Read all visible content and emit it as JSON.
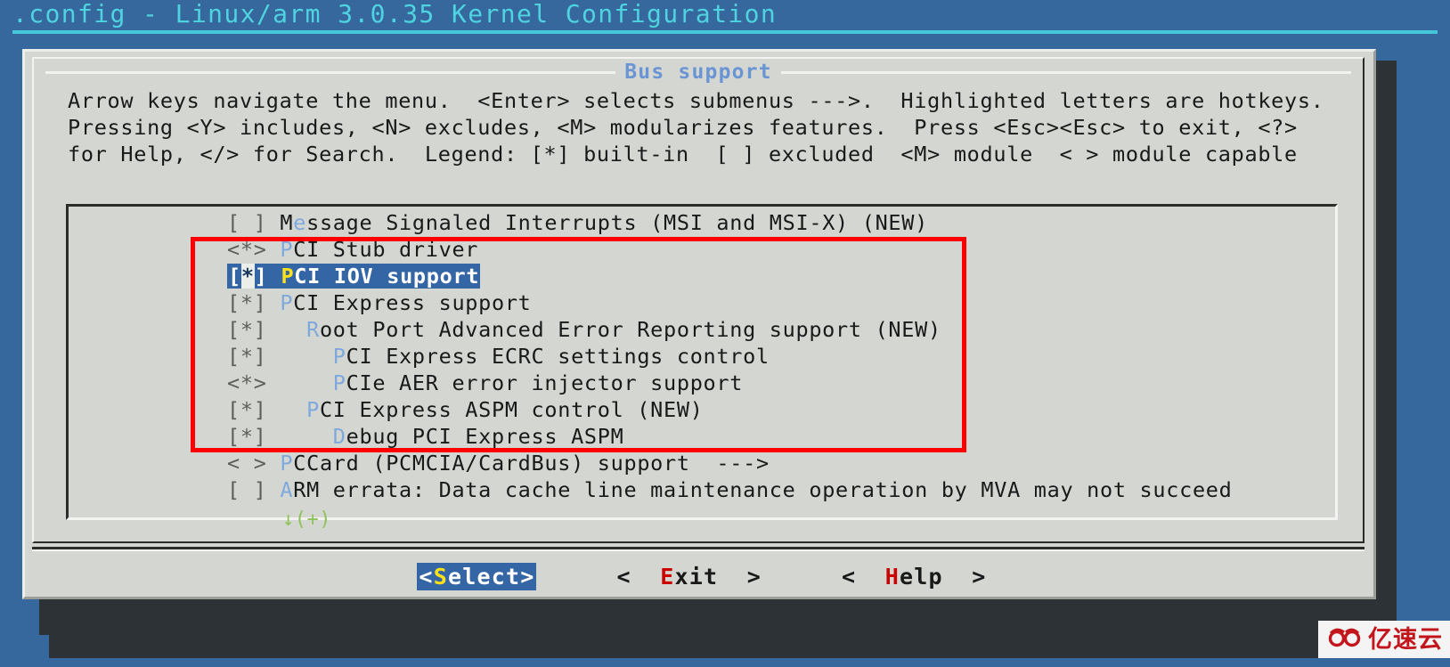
{
  "terminal": {
    "title": ".config - Linux/arm 3.0.35 Kernel Configuration",
    "title_color": "#4fd3e0",
    "background_color": "#36689e"
  },
  "dialog": {
    "caption": "Bus support",
    "caption_color": "#6a94d4",
    "background_color": "#d4d7d1",
    "help_text": "Arrow keys navigate the menu.  <Enter> selects submenus --->.  Highlighted letters are hotkeys.  Pressing <Y> includes, <N> excludes, <M> modularizes features.  Press <Esc><Esc> to exit, <?> for Help, </> for Search.  Legend: [*] built-in  [ ] excluded  <M> module  < > module capable"
  },
  "menu": {
    "scroll_indicator": "↓(+)",
    "scroll_indicator_color": "#8fc25a",
    "selected_index": 2,
    "items": [
      {
        "tag": "[ ]",
        "indent": 0,
        "hotkey": "e",
        "pre": "M",
        "post": "ssage Signaled Interrupts (MSI and MSI-X) (NEW)",
        "selected": false
      },
      {
        "tag": "<*>",
        "indent": 0,
        "hotkey": "P",
        "pre": "",
        "post": "CI Stub driver",
        "selected": false
      },
      {
        "tag": "[*]",
        "indent": 0,
        "hotkey": "P",
        "pre": "",
        "post": "CI IOV support",
        "selected": true
      },
      {
        "tag": "[*]",
        "indent": 0,
        "hotkey": "P",
        "pre": "",
        "post": "CI Express support",
        "selected": false
      },
      {
        "tag": "[*]",
        "indent": 1,
        "hotkey": "R",
        "pre": "",
        "post": "oot Port Advanced Error Reporting support (NEW)",
        "selected": false
      },
      {
        "tag": "[*]",
        "indent": 2,
        "hotkey": "P",
        "pre": "",
        "post": "CI Express ECRC settings control",
        "selected": false
      },
      {
        "tag": "<*>",
        "indent": 2,
        "hotkey": "P",
        "pre": "",
        "post": "CIe AER error injector support",
        "selected": false
      },
      {
        "tag": "[*]",
        "indent": 1,
        "hotkey": "P",
        "pre": "",
        "post": "CI Express ASPM control (NEW)",
        "selected": false
      },
      {
        "tag": "[*]",
        "indent": 2,
        "hotkey": "D",
        "pre": "",
        "post": "ebug PCI Express ASPM",
        "selected": false
      },
      {
        "tag": "< >",
        "indent": 0,
        "hotkey": "P",
        "pre": "",
        "post": "CCard (PCMCIA/CardBus) support  --->",
        "selected": false
      },
      {
        "tag": "[ ]",
        "indent": 0,
        "hotkey": "A",
        "pre": "",
        "post": "RM errata: Data cache line maintenance operation by MVA may not succeed",
        "selected": false
      }
    ]
  },
  "buttons": [
    {
      "label": "<Select>",
      "hotkey": "S",
      "pre": "<",
      "post": "elect>",
      "active": true
    },
    {
      "label": "< Exit >",
      "hotkey": "E",
      "pre": "<  ",
      "post": "xit  >",
      "active": false
    },
    {
      "label": "< Help >",
      "hotkey": "H",
      "pre": "<  ",
      "post": "elp  >",
      "active": false
    }
  ],
  "annotation": {
    "type": "highlight-rectangle",
    "color": "#ff0000",
    "covers_items": [
      "PCI Stub driver",
      "PCI IOV support",
      "PCI Express support",
      "Root Port Advanced Error Reporting support (NEW)",
      "PCI Express ECRC settings control",
      "PCIe AER error injector support",
      "PCI Express ASPM control (NEW)",
      "Debug PCI Express ASPM"
    ]
  },
  "watermark": {
    "text": "亿速云",
    "color": "#c3161c"
  }
}
